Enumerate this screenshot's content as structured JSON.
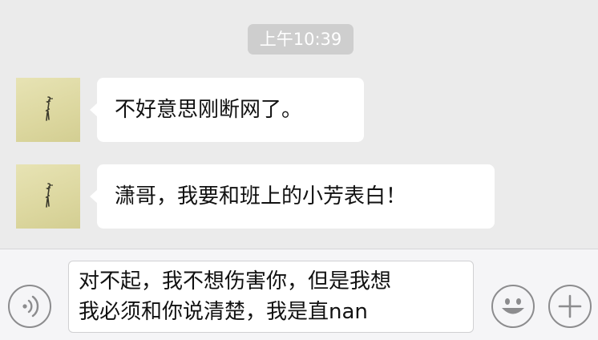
{
  "timestamp": "上午10:39",
  "messages": [
    {
      "sender": "contact",
      "text": "不好意思刚断网了。"
    },
    {
      "sender": "contact",
      "text": "潇哥，我要和班上的小芳表白！"
    }
  ],
  "input": {
    "lines": [
      "对不起，我不想伤害你，但是我想",
      "我必须和你说清楚，我是直nan"
    ]
  },
  "icons": {
    "voice": "voice-icon",
    "emoji": "emoji-icon",
    "plus": "plus-icon",
    "avatar": "bird-avatar"
  },
  "colors": {
    "background": "#ebebeb",
    "bubble": "#ffffff",
    "timestamp_bg": "#cecece",
    "input_bar": "#f5f5f7",
    "icon_stroke": "#8c8c8e"
  }
}
